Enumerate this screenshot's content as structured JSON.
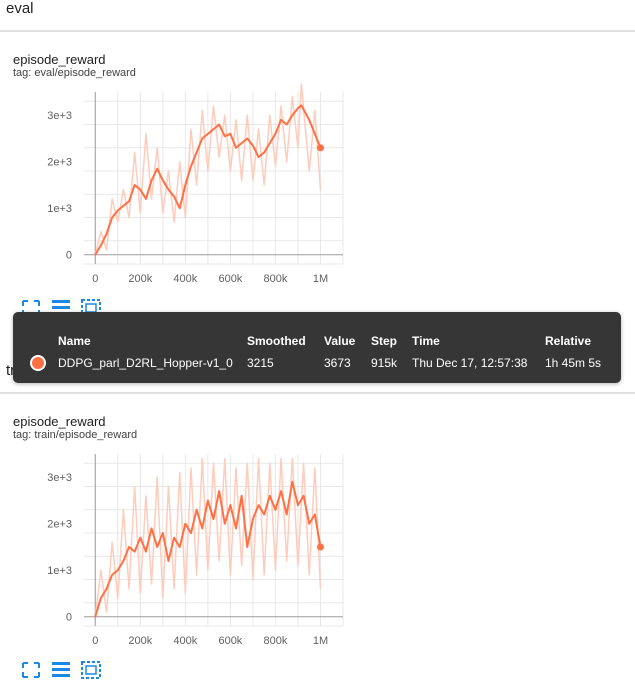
{
  "sections": [
    {
      "label": "eval"
    },
    {
      "label": "train"
    }
  ],
  "cards": [
    {
      "title": "episode_reward",
      "tag": "tag: eval/episode_reward"
    },
    {
      "title": "episode_reward",
      "tag": "tag: train/episode_reward"
    }
  ],
  "toolbar": {
    "icons": [
      "fit-domain-icon",
      "toggle-log-icon",
      "download-icon"
    ]
  },
  "tooltip": {
    "headers": {
      "name": "Name",
      "smoothed": "Smoothed",
      "value": "Value",
      "step": "Step",
      "time": "Time",
      "relative": "Relative"
    },
    "row": {
      "name": "DDPG_parl_D2RL_Hopper-v1_0",
      "smoothed": "3215",
      "value": "3673",
      "step": "915k",
      "time": "Thu Dec 17, 12:57:38",
      "relative": "1h 45m 5s"
    },
    "series_color": "#ff7043"
  },
  "chart_data": [
    {
      "type": "line",
      "title": "episode_reward",
      "xlabel": "",
      "ylabel": "",
      "xlim": [
        -50000,
        1100000
      ],
      "ylim": [
        -200,
        3500
      ],
      "x_ticks": [
        "0",
        "200k",
        "400k",
        "600k",
        "800k",
        "1M"
      ],
      "x_tick_values": [
        0,
        200000,
        400000,
        600000,
        800000,
        1000000
      ],
      "y_ticks": [
        "0",
        "1e+3",
        "2e+3",
        "3e+3"
      ],
      "y_tick_values": [
        0,
        1000,
        2000,
        3000
      ],
      "grid": true,
      "series": [
        {
          "kind": "smoothed",
          "color": "#ff7043",
          "x": [
            0,
            25000,
            50000,
            75000,
            100000,
            125000,
            150000,
            175000,
            200000,
            225000,
            250000,
            275000,
            300000,
            325000,
            350000,
            375000,
            400000,
            425000,
            450000,
            475000,
            500000,
            525000,
            550000,
            575000,
            600000,
            625000,
            650000,
            675000,
            700000,
            725000,
            750000,
            775000,
            800000,
            825000,
            850000,
            875000,
            900000,
            915000,
            950000,
            975000,
            1000000
          ],
          "y": [
            0,
            200,
            450,
            800,
            950,
            1050,
            1150,
            1500,
            1400,
            1200,
            1600,
            1850,
            1600,
            1400,
            1250,
            1000,
            1500,
            1900,
            2200,
            2500,
            2600,
            2700,
            2800,
            2550,
            2600,
            2300,
            2400,
            2500,
            2350,
            2100,
            2200,
            2400,
            2600,
            2900,
            2800,
            3000,
            3150,
            3215,
            2900,
            2600,
            2300
          ]
        },
        {
          "kind": "raw",
          "color": "#ffccbc",
          "x": [
            0,
            25000,
            50000,
            75000,
            100000,
            125000,
            150000,
            175000,
            200000,
            225000,
            250000,
            275000,
            300000,
            325000,
            350000,
            375000,
            400000,
            425000,
            450000,
            475000,
            500000,
            525000,
            550000,
            575000,
            600000,
            625000,
            650000,
            675000,
            700000,
            725000,
            750000,
            775000,
            800000,
            825000,
            850000,
            875000,
            900000,
            915000,
            950000,
            975000,
            1000000
          ],
          "y": [
            0,
            500,
            100,
            1200,
            700,
            1400,
            800,
            2200,
            900,
            2600,
            1200,
            2300,
            900,
            1800,
            700,
            2000,
            800,
            2700,
            1500,
            3100,
            1800,
            3200,
            2100,
            3000,
            1800,
            2900,
            1600,
            3000,
            1600,
            2700,
            1500,
            3000,
            1900,
            3200,
            2000,
            3400,
            2300,
            3673,
            1800,
            3100,
            1400
          ]
        }
      ]
    },
    {
      "type": "line",
      "title": "episode_reward",
      "xlabel": "",
      "ylabel": "",
      "xlim": [
        -50000,
        1100000
      ],
      "ylim": [
        -200,
        3500
      ],
      "x_ticks": [
        "0",
        "200k",
        "400k",
        "600k",
        "800k",
        "1M"
      ],
      "x_tick_values": [
        0,
        200000,
        400000,
        600000,
        800000,
        1000000
      ],
      "y_ticks": [
        "0",
        "1e+3",
        "2e+3",
        "3e+3"
      ],
      "y_tick_values": [
        0,
        1000,
        2000,
        3000
      ],
      "grid": true,
      "series": [
        {
          "kind": "smoothed",
          "color": "#ff7043",
          "x": [
            0,
            25000,
            50000,
            75000,
            100000,
            125000,
            150000,
            175000,
            200000,
            225000,
            250000,
            275000,
            300000,
            325000,
            350000,
            375000,
            400000,
            425000,
            450000,
            475000,
            500000,
            525000,
            550000,
            575000,
            600000,
            625000,
            650000,
            675000,
            700000,
            725000,
            750000,
            775000,
            800000,
            825000,
            850000,
            875000,
            900000,
            925000,
            950000,
            975000,
            1000000
          ],
          "y": [
            0,
            400,
            600,
            900,
            1000,
            1200,
            1500,
            1400,
            1700,
            1400,
            1900,
            1500,
            1800,
            1200,
            1700,
            1500,
            2000,
            1800,
            2300,
            1900,
            2500,
            2100,
            2700,
            2000,
            2400,
            1900,
            2600,
            1500,
            2100,
            2400,
            2200,
            2600,
            2300,
            2700,
            2200,
            2900,
            2400,
            2600,
            2000,
            2200,
            1500
          ]
        },
        {
          "kind": "raw",
          "color": "#ffccbc",
          "x": [
            0,
            25000,
            50000,
            75000,
            100000,
            125000,
            150000,
            175000,
            200000,
            225000,
            250000,
            275000,
            300000,
            325000,
            350000,
            375000,
            400000,
            425000,
            450000,
            475000,
            500000,
            525000,
            550000,
            575000,
            600000,
            625000,
            650000,
            675000,
            700000,
            725000,
            750000,
            775000,
            800000,
            825000,
            850000,
            875000,
            900000,
            925000,
            950000,
            975000,
            1000000
          ],
          "y": [
            0,
            1000,
            100,
            1600,
            400,
            2300,
            600,
            2800,
            500,
            2600,
            700,
            3000,
            400,
            2800,
            600,
            3100,
            500,
            3200,
            900,
            3400,
            1000,
            3300,
            1200,
            3400,
            900,
            3200,
            1100,
            3300,
            800,
            3400,
            900,
            3300,
            1000,
            3400,
            1200,
            3400,
            1100,
            3300,
            900,
            3200,
            600
          ]
        }
      ]
    }
  ]
}
